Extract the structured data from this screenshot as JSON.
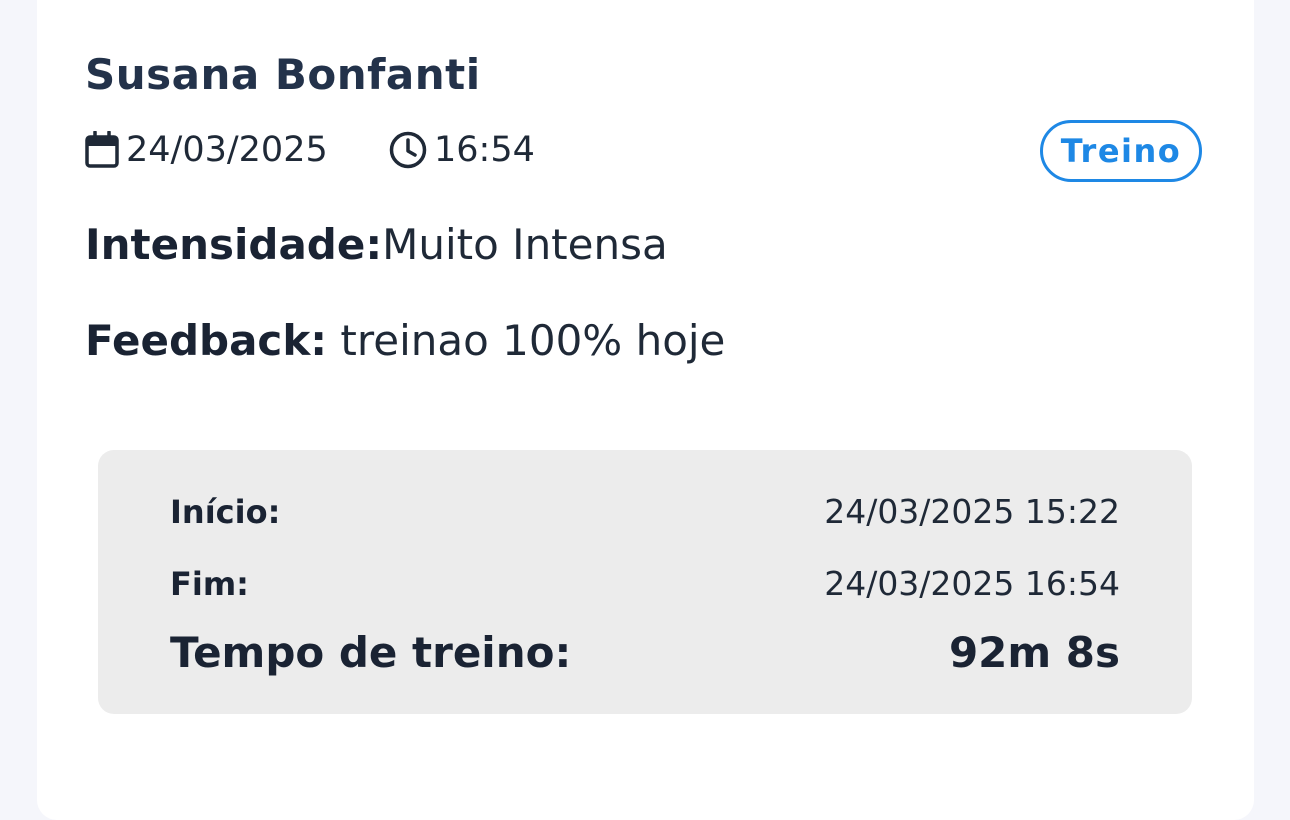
{
  "card": {
    "name": "Susana Bonfanti",
    "date": "24/03/2025",
    "time": "16:54",
    "badge": "Treino",
    "intensity_label": "Intensidade:",
    "intensity_value": "Muito Intensa",
    "feedback_label": "Feedback:",
    "feedback_value": "treinao 100% hoje"
  },
  "summary": {
    "start_label": "Início:",
    "start_value": "24/03/2025 15:22",
    "end_label": "Fim:",
    "end_value": "24/03/2025 16:54",
    "duration_label": "Tempo de treino:",
    "duration_value": "92m 8s"
  },
  "icons": {
    "date": "calendar-icon",
    "time": "clock-icon"
  },
  "colors": {
    "accent": "#1e88e5",
    "text": "#1a2333",
    "summary_bg": "#ececec"
  }
}
